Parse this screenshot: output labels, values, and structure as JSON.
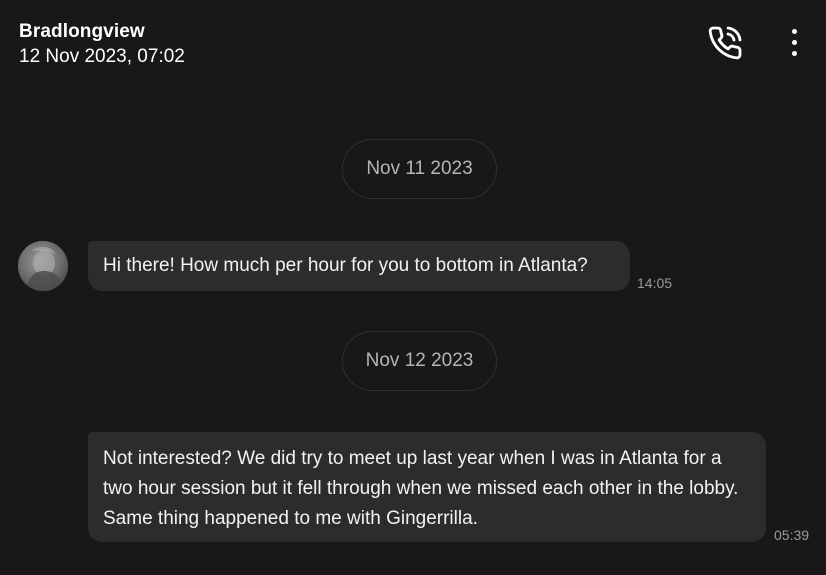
{
  "header": {
    "title": "Bradlongview",
    "subtitle": "12 Nov 2023, 07:02"
  },
  "actions": {
    "call_icon": "phone-call-icon",
    "more_icon": "more-vertical-icon"
  },
  "conversation": {
    "dates": [
      "Nov 11 2023",
      "Nov 12 2023"
    ],
    "messages": [
      {
        "text": "Hi there! How much per hour for you to bottom in Atlanta?",
        "time": "14:05"
      },
      {
        "text": "Not interested? We did try to meet up last year when I was in Atlanta for a two hour session but it fell through when we missed each other in the lobby. Same thing happened to me with Gingerrilla.",
        "time": "05:39"
      }
    ]
  },
  "colors": {
    "background": "#181818",
    "bubble": "#2c2c2c",
    "chip_border": "#303030",
    "muted_text": "#9a9a9a"
  }
}
